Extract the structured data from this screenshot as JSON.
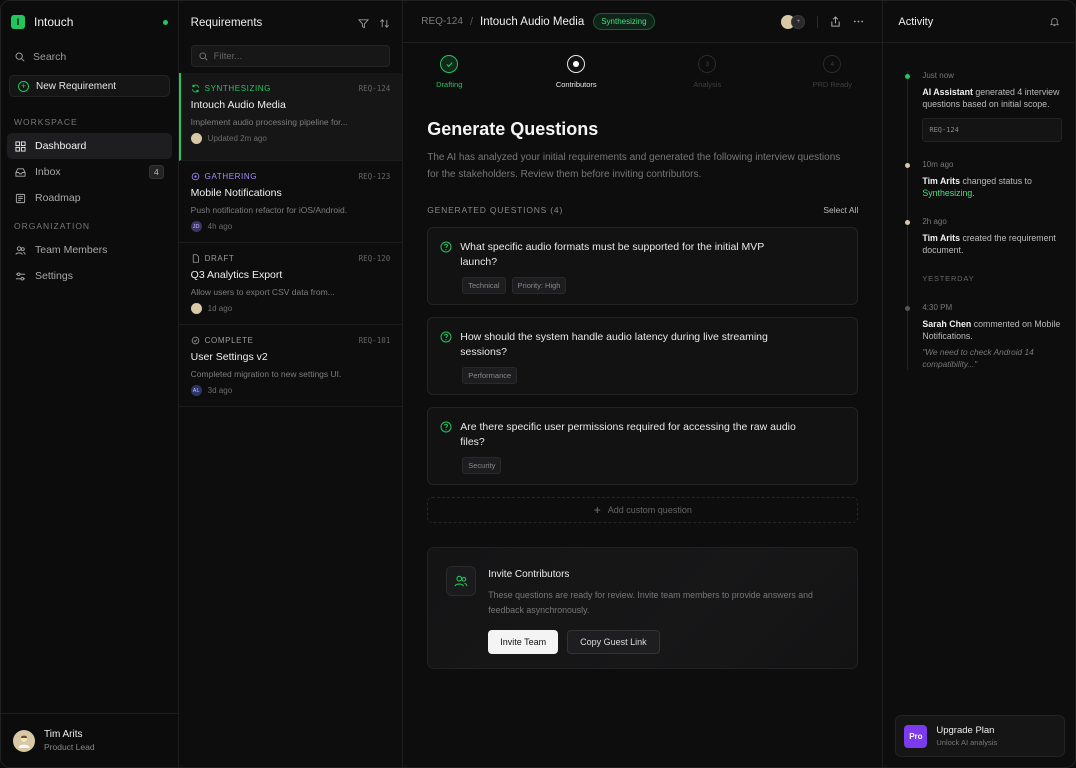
{
  "brand": {
    "logo_letter": "I",
    "name": "Intouch"
  },
  "sidebar": {
    "search_label": "Search",
    "new_requirement_label": "New Requirement",
    "workspace_label": "WORKSPACE",
    "organization_label": "ORGANIZATION",
    "items": [
      {
        "label": "Dashboard",
        "icon": "grid-icon",
        "active": true
      },
      {
        "label": "Inbox",
        "icon": "inbox-icon",
        "badge": "4"
      },
      {
        "label": "Roadmap",
        "icon": "roadmap-icon"
      },
      {
        "label": "Team Members",
        "icon": "users-icon"
      },
      {
        "label": "Settings",
        "icon": "sliders-icon"
      }
    ],
    "user": {
      "name": "Tim Arits",
      "role": "Product Lead"
    }
  },
  "requirements": {
    "title": "Requirements",
    "filter_placeholder": "Filter...",
    "cards": [
      {
        "status": "SYNTHESIZING",
        "status_color": "#22c55e",
        "id": "REQ-124",
        "name": "Intouch Audio Media",
        "desc": "Implement audio processing pipeline for...",
        "meta": "Updated 2m ago",
        "avatar": ""
      },
      {
        "status": "GATHERING",
        "status_color": "#a78bfa",
        "id": "REQ-123",
        "name": "Mobile Notifications",
        "desc": "Push notification refactor for iOS/Android.",
        "meta": "4h ago",
        "avatar": "JD"
      },
      {
        "status": "DRAFT",
        "status_color": "#9a9a9a",
        "id": "REQ-120",
        "name": "Q3 Analytics Export",
        "desc": "Allow users to export CSV data from...",
        "meta": "1d ago",
        "avatar": ""
      },
      {
        "status": "COMPLETE",
        "status_color": "#9a9a9a",
        "id": "REQ-101",
        "name": "User Settings v2",
        "desc": "Completed migration to new settings UI.",
        "meta": "3d ago",
        "avatar": "AL"
      }
    ]
  },
  "main": {
    "breadcrumb_id": "REQ-124",
    "breadcrumb_sep": "/",
    "title": "Intouch Audio Media",
    "status": "Synthesizing",
    "avatar_extra": "+",
    "steps": [
      {
        "label": "Drafting",
        "state": "done",
        "num": ""
      },
      {
        "label": "Contributors",
        "state": "current",
        "num": ""
      },
      {
        "label": "Analysis",
        "state": "todo",
        "num": "3"
      },
      {
        "label": "PRD Ready",
        "state": "todo",
        "num": "4"
      }
    ],
    "heading": "Generate Questions",
    "lead": "The AI has analyzed your initial requirements and generated the following interview questions for the stakeholders. Review them before inviting contributors.",
    "questions_header": "GENERATED QUESTIONS (4)",
    "select_all": "Select All",
    "questions": [
      {
        "text": "What specific audio formats must be supported for the initial MVP launch?",
        "tags": [
          "Technical",
          "Priority: High"
        ]
      },
      {
        "text": "How should the system handle audio latency during live streaming sessions?",
        "tags": [
          "Performance"
        ]
      },
      {
        "text": "Are there specific user permissions required for accessing the raw audio files?",
        "tags": [
          "Security"
        ]
      }
    ],
    "add_question": "Add custom question",
    "invite": {
      "title": "Invite Contributors",
      "desc": "These questions are ready for review. Invite team members to provide answers and feedback asynchronously.",
      "primary": "Invite Team",
      "secondary": "Copy Guest Link"
    }
  },
  "activity": {
    "title": "Activity",
    "items": [
      {
        "time": "Just now",
        "actor": "AI Assistant",
        "text": " generated 4 interview questions based on initial scope.",
        "ref": "REQ-124",
        "dot": "#22c55e"
      },
      {
        "time": "10m ago",
        "actor": "Tim Arits",
        "text": " changed status to ",
        "highlight": "Synthesizing",
        "tail": ".",
        "dot": "#d9c8a6"
      },
      {
        "time": "2h ago",
        "actor": "Tim Arits",
        "text": " created the requirement document.",
        "dot": "#d9c8a6"
      }
    ],
    "divider": "YESTERDAY",
    "yesterday": [
      {
        "time": "4:30 PM",
        "actor": "Sarah Chen",
        "text": " commented on Mobile Notifications.",
        "quote": "\"We need to check Android 14 compatibility...\"",
        "dot": "#555"
      }
    ],
    "upgrade": {
      "badge": "Pro",
      "title": "Upgrade Plan",
      "sub": "Unlock AI analysis"
    }
  }
}
